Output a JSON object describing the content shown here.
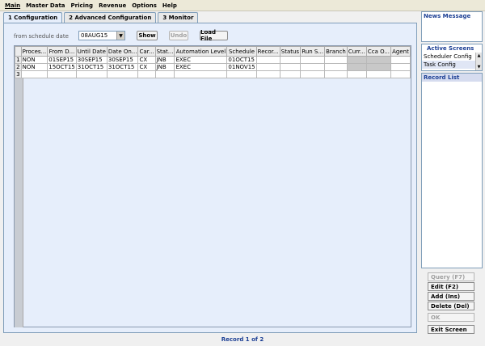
{
  "menu": [
    "Main",
    "Master Data",
    "Pricing",
    "Revenue",
    "Options",
    "Help"
  ],
  "tabs": [
    "1 Configuration",
    "2 Advanced Configuration",
    "3 Monitor"
  ],
  "filter": {
    "label": "from schedule date",
    "value": "08AUG15",
    "show": "Show",
    "undo": "Undo",
    "load_file": "Load File"
  },
  "grid": {
    "columns": [
      "Proces...",
      "From D...",
      "Until Date",
      "Date On...",
      "Car...",
      "Stat...",
      "Automation Level",
      "Schedule",
      "Recor...",
      "Status",
      "Run S...",
      "Branch",
      "Curr...",
      "Cca O...",
      "Agent"
    ],
    "rows": [
      {
        "num": "1",
        "cells": [
          "NON",
          "01SEP15",
          "30SEP15",
          "30SEP15",
          "CX",
          "JNB",
          "EXEC",
          "01OCT15",
          "",
          "",
          "",
          "",
          "",
          "",
          ""
        ]
      },
      {
        "num": "2",
        "cells": [
          "NON",
          "15OCT15",
          "31OCT15",
          "31OCT15",
          "CX",
          "JNB",
          "EXEC",
          "01NOV15",
          "",
          "",
          "",
          "",
          "",
          "",
          ""
        ]
      },
      {
        "num": "3",
        "cells": [
          "",
          "",
          "",
          "",
          "",
          "",
          "",
          "",
          "",
          "",
          "",
          "",
          "",
          "",
          ""
        ]
      }
    ]
  },
  "status": "Record 1  of 2",
  "sidebar": {
    "news_title": "News Message",
    "active_title": "Active Screens",
    "active_items": [
      "Scheduler Config",
      "Task Config"
    ],
    "record_list_title": "Record List"
  },
  "actions": {
    "query": "Query (F7)",
    "edit": "Edit (F2)",
    "add": "Add (Ins)",
    "delete": "Delete (Del)",
    "ok": "OK",
    "exit": "Exit Screen"
  }
}
